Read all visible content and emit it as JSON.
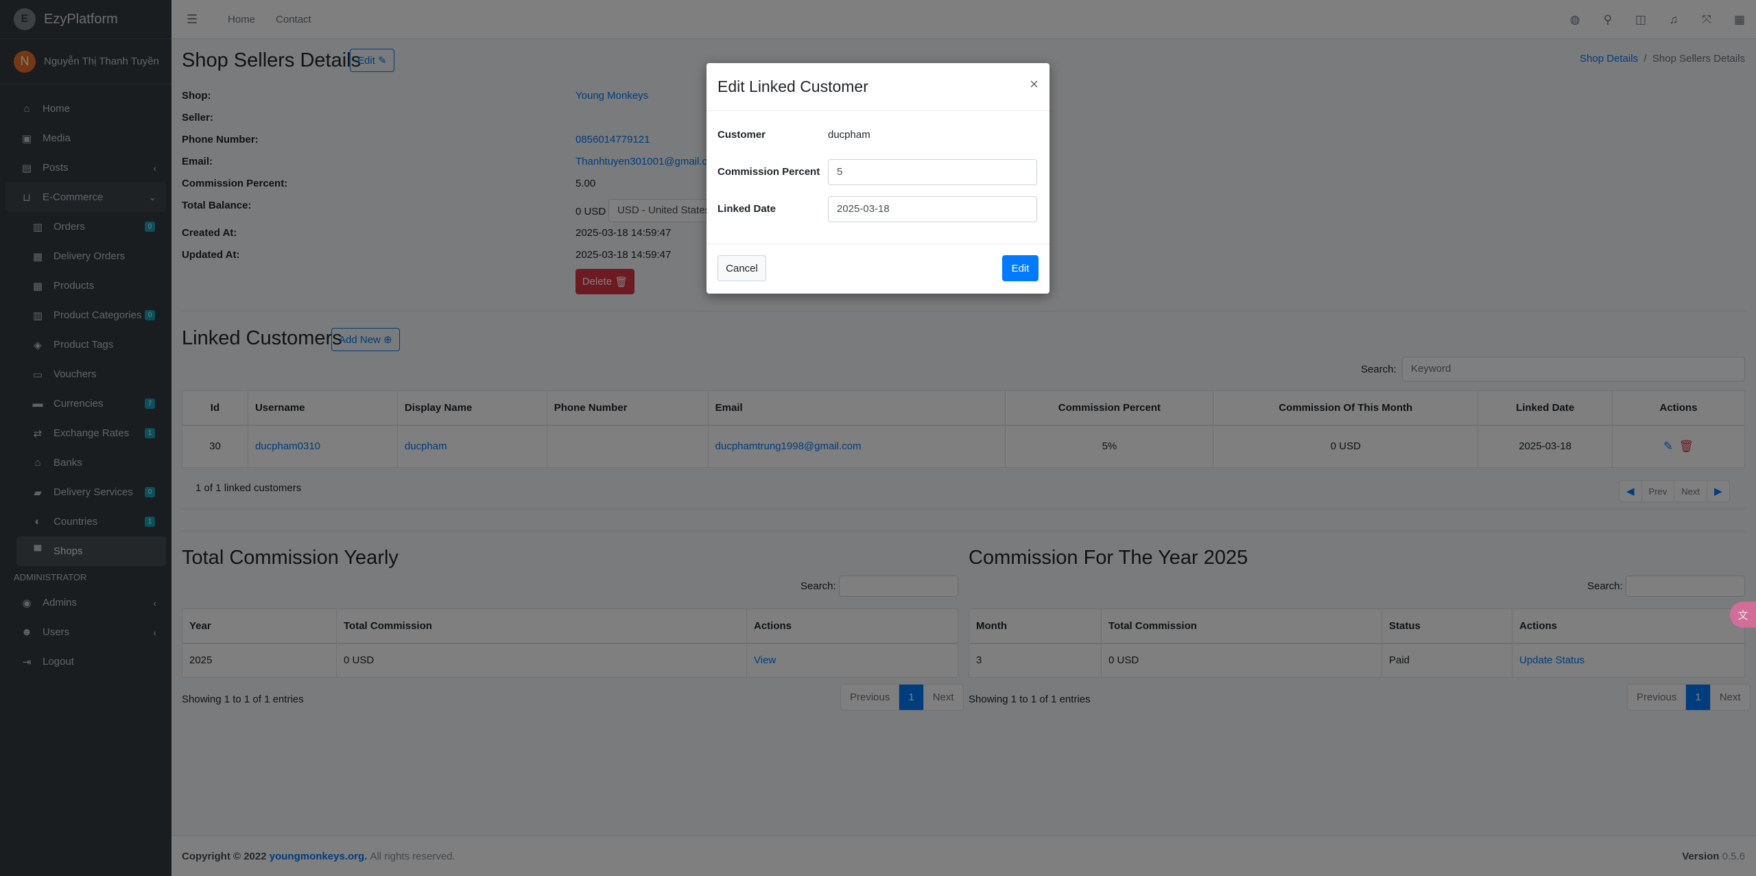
{
  "brand": {
    "name": "EzyPlatform"
  },
  "user": {
    "initial": "N",
    "name": "Nguyễn Thị Thanh Tuyền"
  },
  "sidebar": {
    "items": [
      {
        "label": "Home",
        "icon": "home-icon"
      },
      {
        "label": "Media",
        "icon": "image-icon"
      },
      {
        "label": "Posts",
        "icon": "posts-icon"
      },
      {
        "label": "E-Commerce",
        "icon": "basket-icon"
      },
      {
        "label": "Orders",
        "icon": "clipboard-icon",
        "badge": "0"
      },
      {
        "label": "Delivery Orders",
        "icon": "truck-loading-icon"
      },
      {
        "label": "Products",
        "icon": "boxes-icon"
      },
      {
        "label": "Product Categories",
        "icon": "clipboard-icon",
        "badge": "0"
      },
      {
        "label": "Product Tags",
        "icon": "tags-icon"
      },
      {
        "label": "Vouchers",
        "icon": "ticket-icon"
      },
      {
        "label": "Currencies",
        "icon": "money-icon",
        "badge": "7"
      },
      {
        "label": "Exchange Rates",
        "icon": "exchange-icon",
        "badge": "1"
      },
      {
        "label": "Banks",
        "icon": "bank-icon"
      },
      {
        "label": "Delivery Services",
        "icon": "truck-icon",
        "badge": "0"
      },
      {
        "label": "Countries",
        "icon": "globe-icon",
        "badge": "1"
      },
      {
        "label": "Shops",
        "icon": "store-icon"
      }
    ],
    "admin_header": "ADMINISTRATOR",
    "admin_items": [
      {
        "label": "Admins",
        "icon": "user-circle-icon"
      },
      {
        "label": "Users",
        "icon": "users-icon"
      },
      {
        "label": "Logout",
        "icon": "logout-icon"
      }
    ]
  },
  "topbar": {
    "links": [
      "Home",
      "Contact"
    ]
  },
  "page": {
    "title": "Shop Sellers Details",
    "edit_label": "Edit",
    "breadcrumb": {
      "parent": "Shop Details",
      "current": "Shop Sellers Details"
    },
    "details": {
      "shop_label": "Shop:",
      "shop_value": "Young Monkeys",
      "seller_label": "Seller:",
      "phone_label": "Phone Number:",
      "phone_value": "0856014779121",
      "email_label": "Email:",
      "email_value": "Thanhtuyen301001@gmail.com",
      "commission_label": "Commission Percent:",
      "commission_value": "5.00",
      "balance_label": "Total Balance:",
      "balance_value": "0 USD",
      "balance_currency": "USD - United States",
      "created_label": "Created At:",
      "created_value": "2025-03-18 14:59:47",
      "updated_label": "Updated At:",
      "updated_value": "2025-03-18 14:59:47"
    },
    "delete_label": "Delete"
  },
  "linked": {
    "title": "Linked Customers",
    "add_label": "Add New",
    "search_label": "Search:",
    "search_placeholder": "Keyword",
    "headers": [
      "Id",
      "Username",
      "Display Name",
      "Phone Number",
      "Email",
      "Commission Percent",
      "Commission Of This Month",
      "Linked Date",
      "Actions"
    ],
    "row": {
      "id": "30",
      "username": "ducpham0310",
      "display": "ducpham",
      "phone": "",
      "email": "ducphamtrung1998@gmail.com",
      "percent": "5%",
      "month": "0 USD",
      "date": "2025-03-18"
    },
    "summary": "1 of 1 linked customers",
    "prev": "Prev",
    "next": "Next"
  },
  "yearly": {
    "title": "Total Commission Yearly",
    "search_label": "Search:",
    "headers": [
      "Year",
      "Total Commission",
      "Actions"
    ],
    "row": {
      "year": "2025",
      "total": "0 USD",
      "action": "View"
    },
    "info": "Showing 1 to 1 of 1 entries",
    "previous": "Previous",
    "page": "1",
    "next": "Next"
  },
  "monthly": {
    "title": "Commission For The Year 2025",
    "search_label": "Search:",
    "headers": [
      "Month",
      "Total Commission",
      "Status",
      "Actions"
    ],
    "row": {
      "month": "3",
      "total": "0 USD",
      "status": "Paid",
      "action": "Update Status"
    },
    "info": "Showing 1 to 1 of 1 entries",
    "previous": "Previous",
    "page": "1",
    "next": "Next"
  },
  "footer": {
    "copyright": "Copyright © 2022",
    "link": "youngmonkeys.org.",
    "rights": "All rights reserved.",
    "version_label": "Version",
    "version": "0.5.6"
  },
  "modal": {
    "title": "Edit Linked Customer",
    "close": "×",
    "customer_label": "Customer",
    "customer_value": "ducpham",
    "percent_label": "Commission Percent",
    "percent_value": "5",
    "date_label": "Linked Date",
    "date_value": "2025-03-18",
    "cancel": "Cancel",
    "edit": "Edit"
  },
  "colors": {
    "primary": "#007bff",
    "danger": "#dc3545",
    "sidebar": "#343a40",
    "badge": "#17a2b8"
  }
}
